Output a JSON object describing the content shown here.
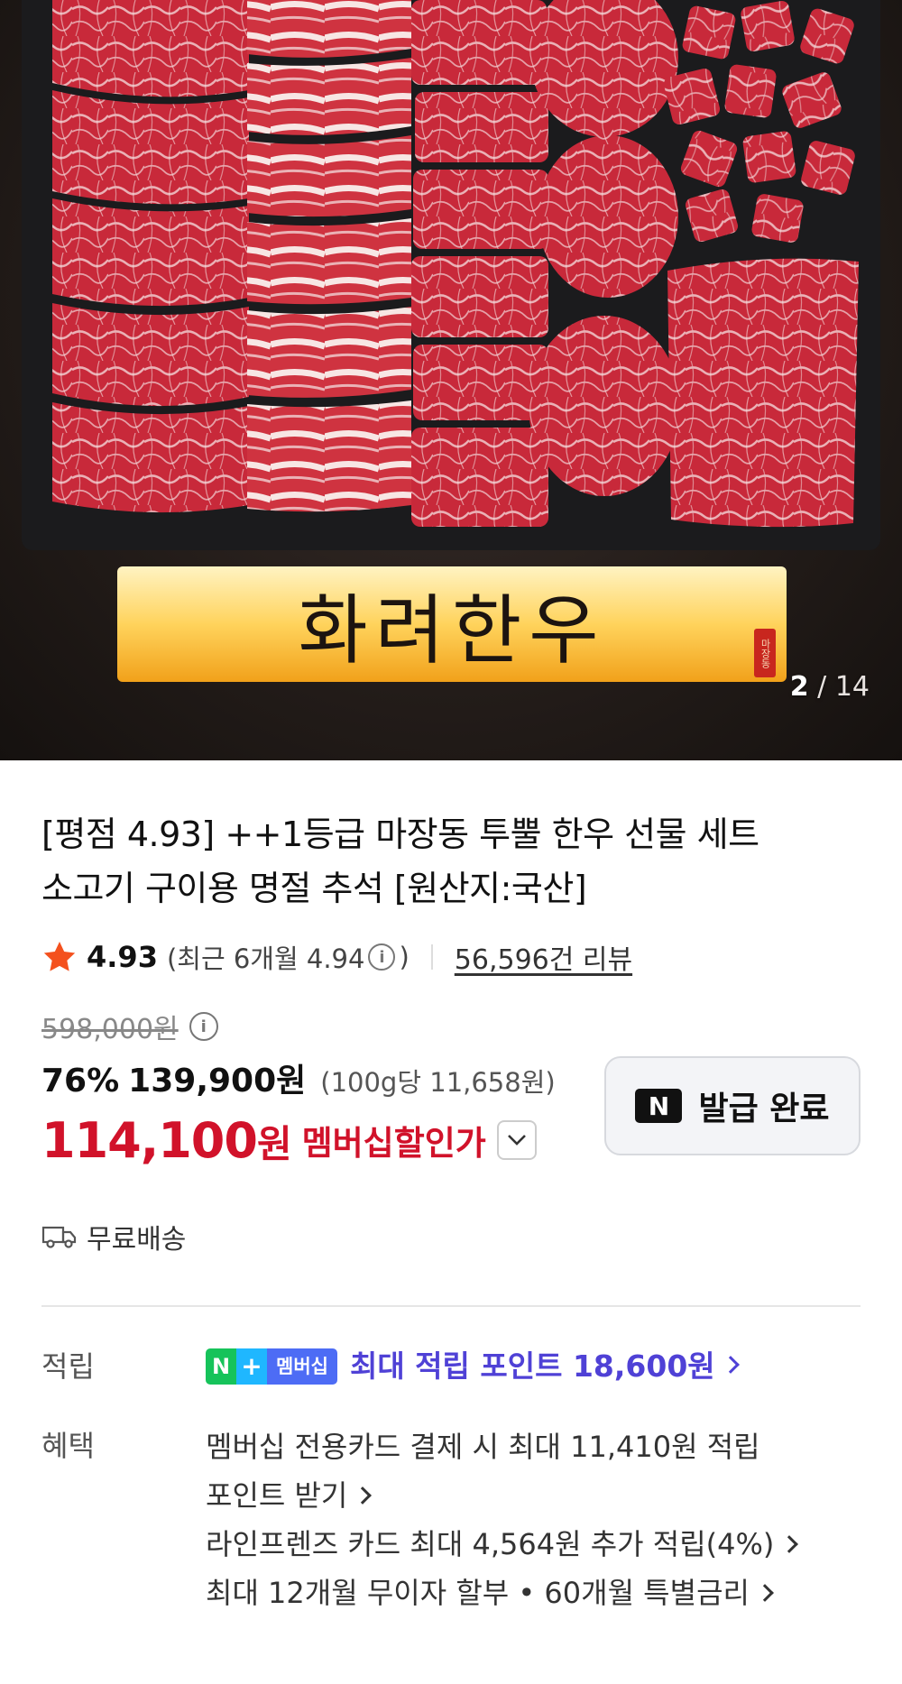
{
  "hero": {
    "banner_text": "화려한우",
    "seal_text": "마장동",
    "counter_current": "2",
    "counter_total": "/ 14"
  },
  "product": {
    "title_line1": "[평점 4.93] ++1등급 마장동 투뿔 한우 선물 세트",
    "title_line2": "소고기 구이용 명절 추석 [원산지:국산]"
  },
  "rating": {
    "score": "4.93",
    "recent_open": "(최근 6개월 4.94",
    "recent_close": ")",
    "info_glyph": "i",
    "reviews": "56,596건 리뷰"
  },
  "price": {
    "original": "598,000원",
    "discount_percent": "76%",
    "sale_price": "139,900원",
    "unit_price": "(100g당 11,658원)",
    "member_price_number": "114,100",
    "member_price_won": "원",
    "member_label": "멤버십할인가"
  },
  "coupon": {
    "logo": "N",
    "label": "발급 완료"
  },
  "shipping": {
    "label": "무료배송"
  },
  "points": {
    "label": "적립",
    "badge_n": "N",
    "badge_plus": "+",
    "badge_membership": "멤버십",
    "text": "최대 적립 포인트 18,600원"
  },
  "benefits": {
    "label": "혜택",
    "items": [
      "멤버십 전용카드 결제 시 최대 11,410원 적립",
      "포인트 받기",
      "라인프렌즈 카드 최대 4,564원 추가 적립(4%)",
      "최대 12개월 무이자 할부 • 60개월 특별금리"
    ]
  },
  "colors": {
    "accent_red": "#d1122a",
    "points_purple": "#4f41d6",
    "naver_green": "#16c35a"
  }
}
